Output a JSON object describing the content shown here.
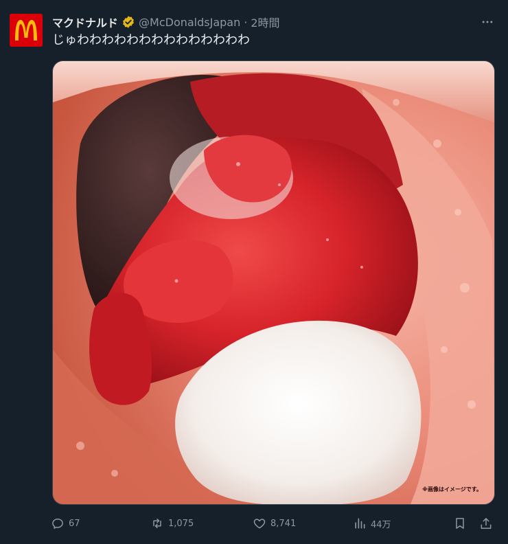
{
  "tweet": {
    "author_name": "マクドナルド",
    "handle": "@McDonaldsJapan",
    "separator": "·",
    "time": "2時間",
    "text": "じゅわわわわわわわわわわわわわわ",
    "image_disclaimer": "※画像はイメージです。",
    "verified_badge_color": "#e2b719",
    "avatar_background": "#db0007",
    "avatar_logo_color": "#ffbc0d"
  },
  "actions": {
    "replies": "67",
    "retweets": "1,075",
    "likes": "8,741",
    "views": "44万"
  },
  "icons": {
    "more": "more-dots-icon",
    "reply": "reply-icon",
    "retweet": "retweet-icon",
    "like": "heart-icon",
    "views": "views-chart-icon",
    "bookmark": "bookmark-icon",
    "share": "share-icon"
  }
}
